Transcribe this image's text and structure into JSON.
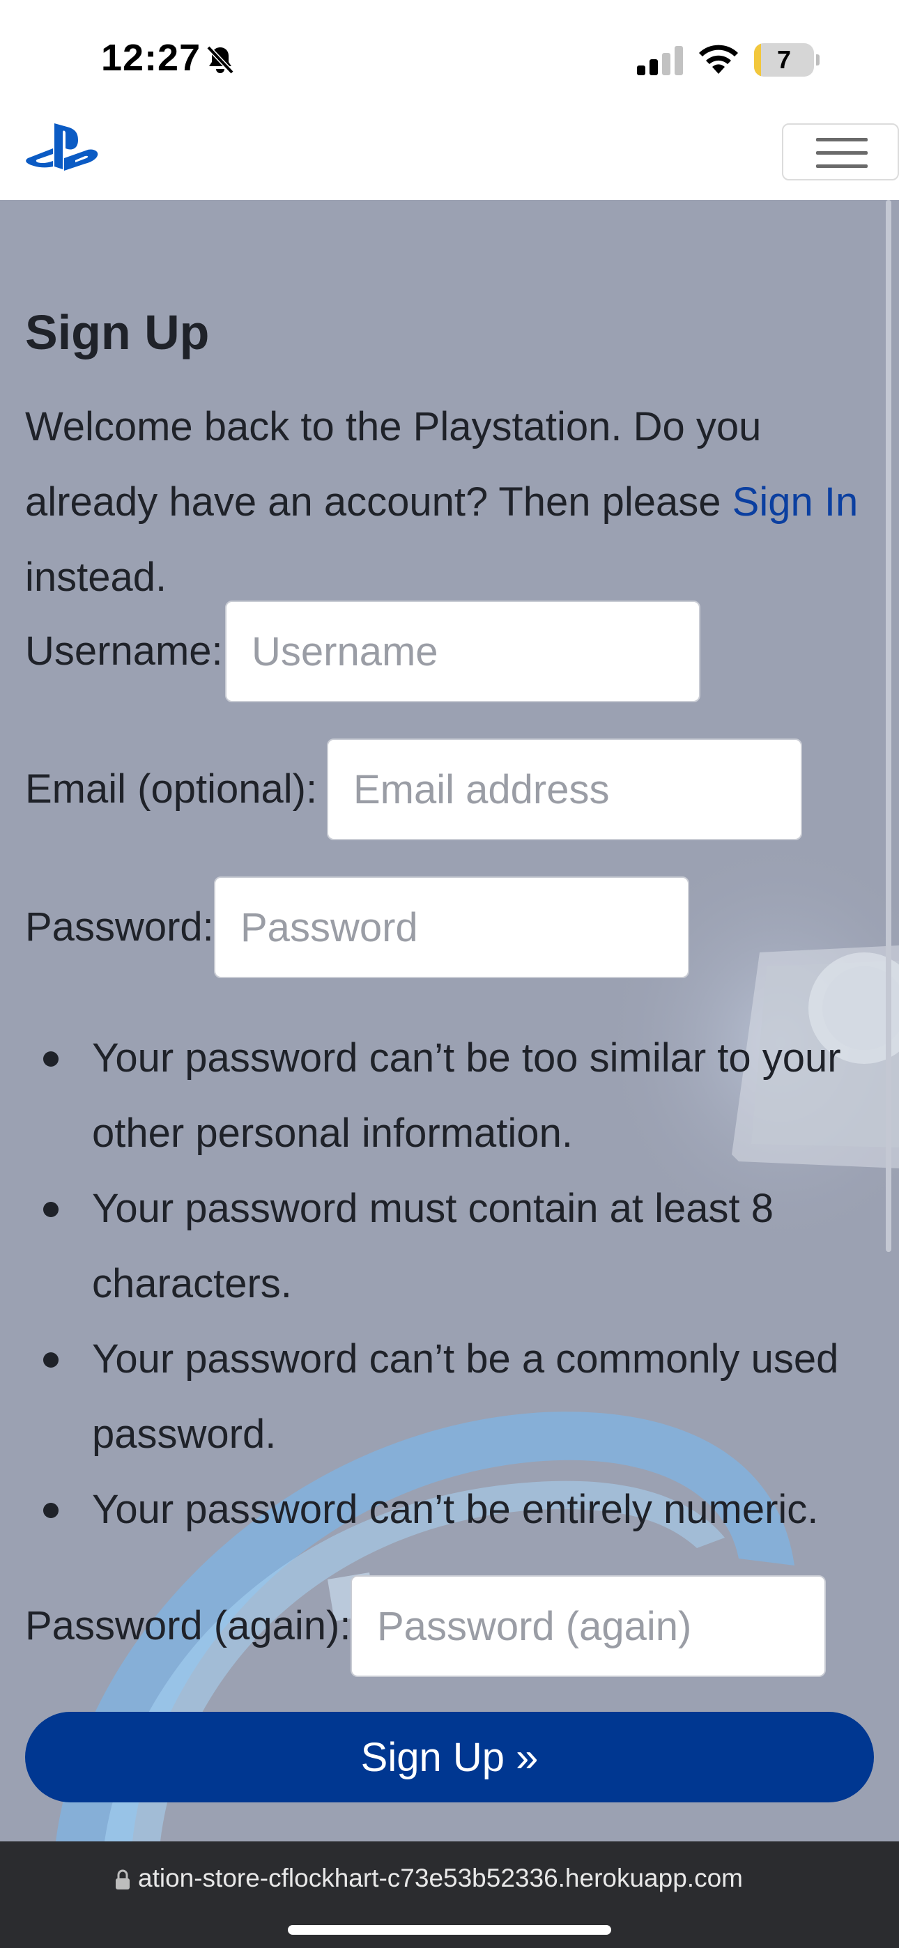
{
  "status_bar": {
    "time": "12:27",
    "battery_level": "7",
    "battery_percent": 7
  },
  "navbar": {
    "logo_icon": "playstation-logo-icon",
    "menu_icon": "hamburger-menu-icon"
  },
  "form": {
    "title": "Sign Up",
    "intro_before": "Welcome back to the Playstation. Do you already have an account? Then please ",
    "signin_link": "Sign In",
    "intro_after": " instead.",
    "username_label": "Username:",
    "username_placeholder": "Username",
    "email_label": "Email (optional):",
    "email_placeholder": "Email address",
    "password_label": "Password:",
    "password_placeholder": "Password",
    "password_rules": [
      "Your password can’t be too similar to your other personal information.",
      "Your password must contain at least 8 characters.",
      "Your password can’t be a commonly used password.",
      "Your password can’t be entirely numeric."
    ],
    "password2_label": "Password (again):",
    "password2_placeholder": "Password (again)",
    "submit_label": "Sign Up »"
  },
  "browser": {
    "url": "ation-store-cflockhart-c73e53b52336.herokuapp.com"
  },
  "colors": {
    "primary": "#003791",
    "link": "#0b3fa0",
    "background": "#9ba1b2",
    "address_bar": "#2b2c2f"
  }
}
